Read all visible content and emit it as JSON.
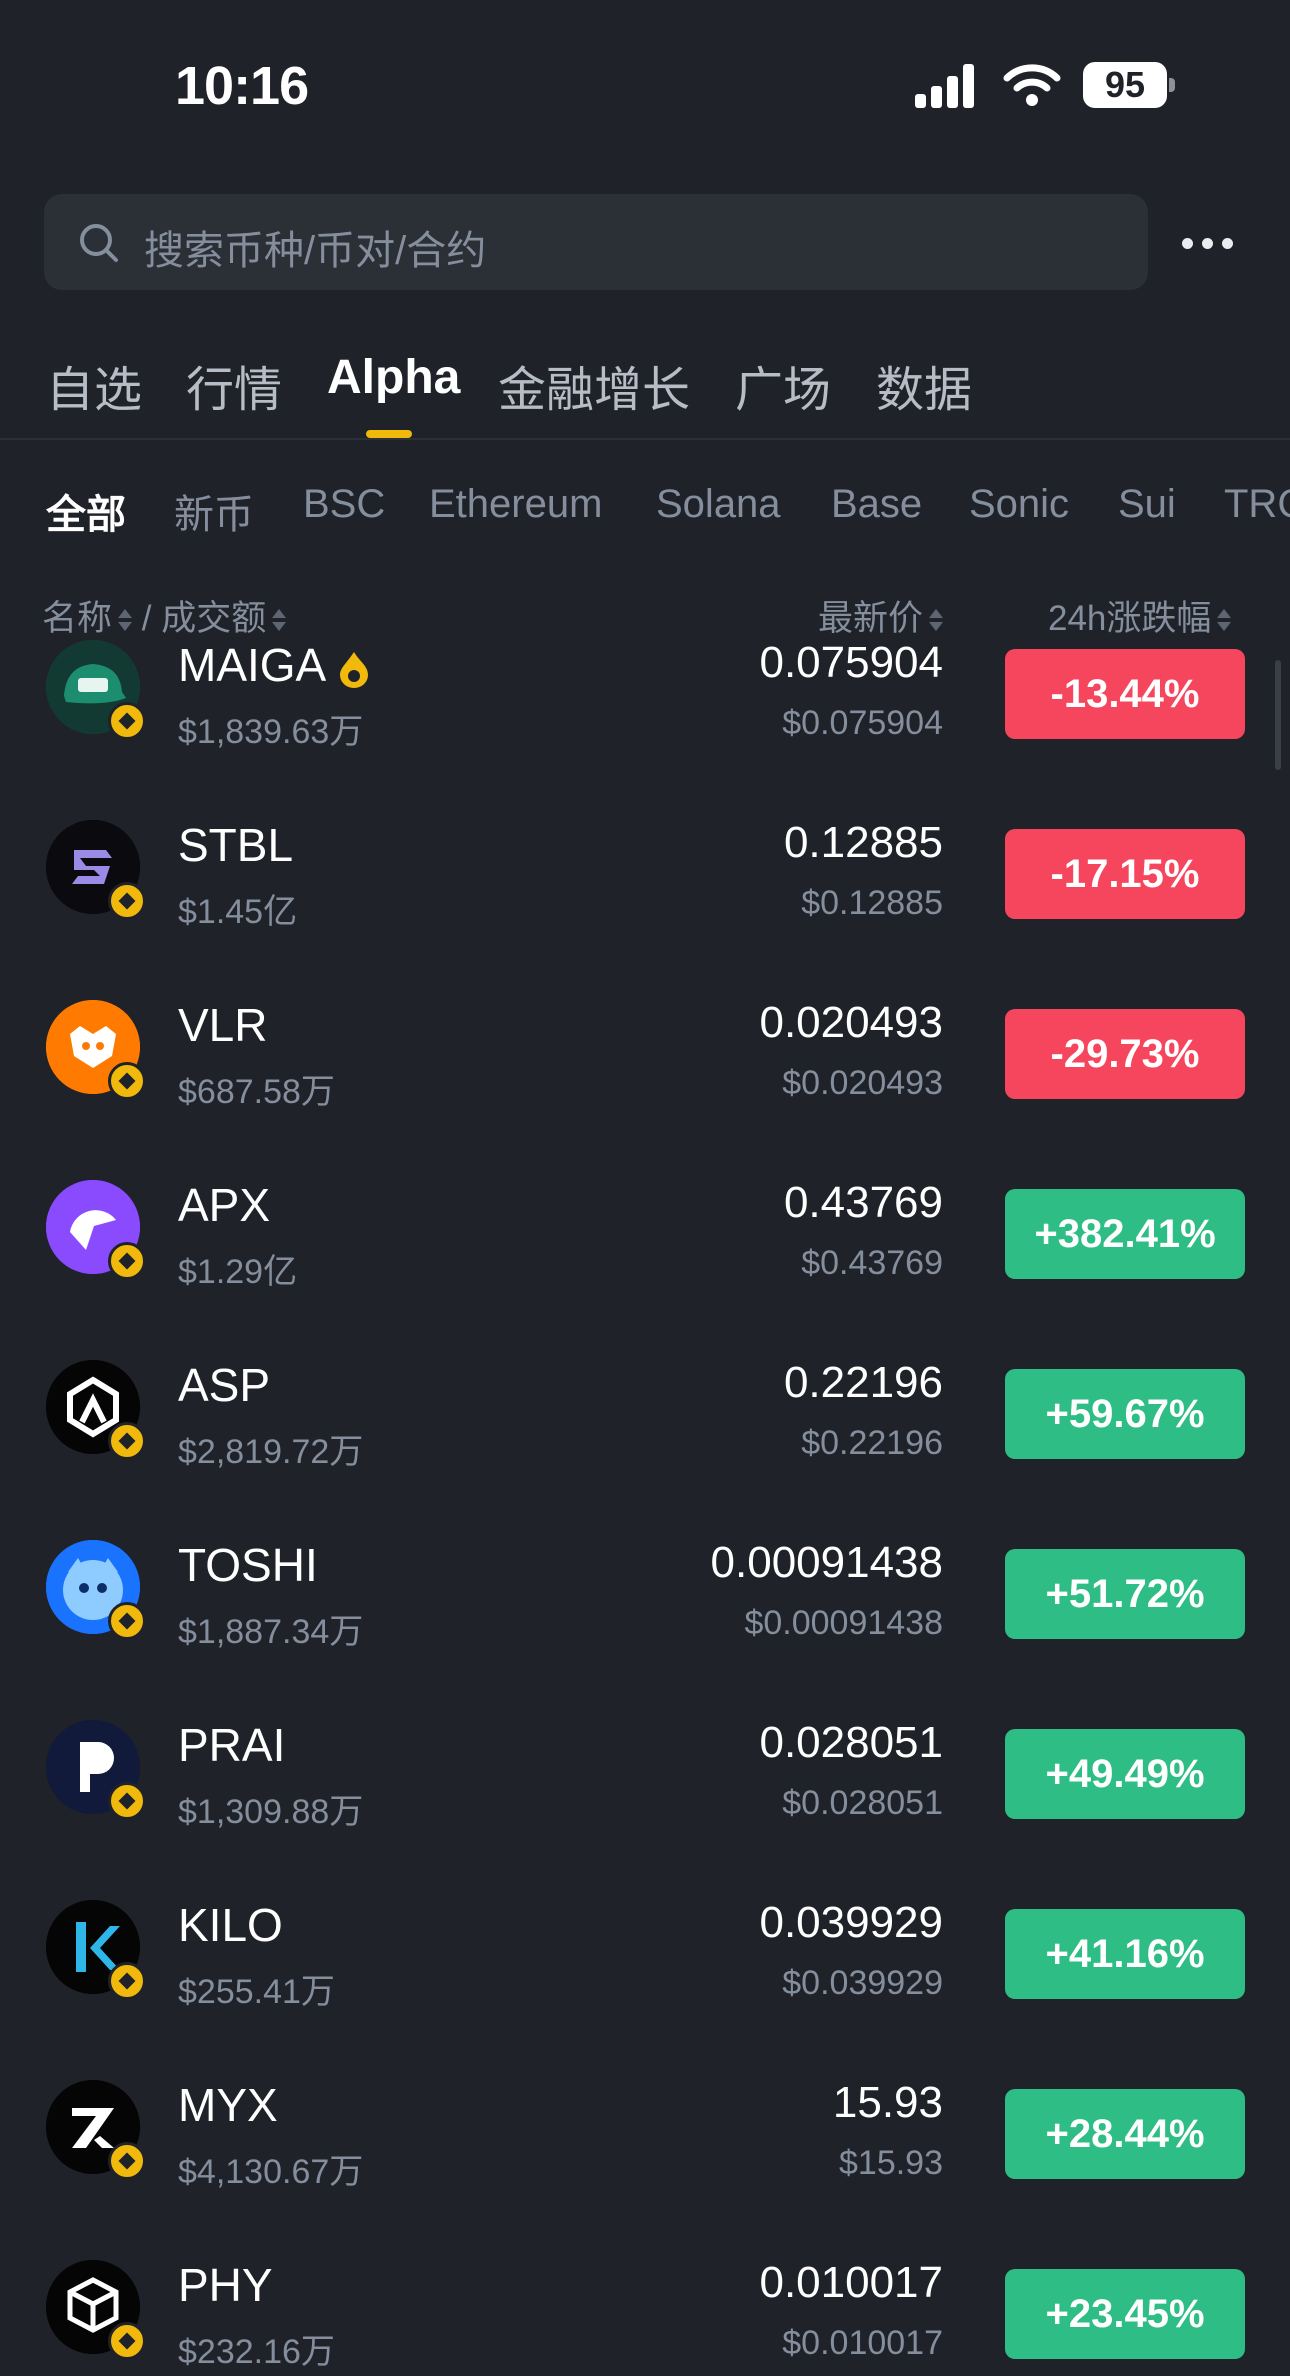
{
  "status_bar": {
    "time": "10:16",
    "battery": "95"
  },
  "search": {
    "placeholder": "搜索币种/币对/合约"
  },
  "main_tabs": [
    "自选",
    "行情",
    "Alpha",
    "金融增长",
    "广场",
    "数据"
  ],
  "chain_tabs": [
    "全部",
    "新币",
    "BSC",
    "Ethereum",
    "Solana",
    "Base",
    "Sonic",
    "Sui",
    "TRC"
  ],
  "columns": {
    "name": "名称",
    "separator": "/",
    "volume": "成交额",
    "price": "最新价",
    "change": "24h涨跌幅"
  },
  "colors": {
    "down": "#f6465d",
    "up": "#2ebd85",
    "accent": "#f0b90b"
  },
  "coins": [
    {
      "name": "MAIGA",
      "volume": "$1,839.63万",
      "price": "0.075904",
      "price_usd": "$0.075904",
      "change": "-13.44%",
      "direction": "down",
      "icon": "maiga-cap-icon",
      "hot": true
    },
    {
      "name": "STBL",
      "volume": "$1.45亿",
      "price": "0.12885",
      "price_usd": "$0.12885",
      "change": "-17.15%",
      "direction": "down",
      "icon": "stbl-logo-icon"
    },
    {
      "name": "VLR",
      "volume": "$687.58万",
      "price": "0.020493",
      "price_usd": "$0.020493",
      "change": "-29.73%",
      "direction": "down",
      "icon": "vlr-fox-icon"
    },
    {
      "name": "APX",
      "volume": "$1.29亿",
      "price": "0.43769",
      "price_usd": "$0.43769",
      "change": "+382.41%",
      "direction": "up",
      "icon": "apx-logo-icon"
    },
    {
      "name": "ASP",
      "volume": "$2,819.72万",
      "price": "0.22196",
      "price_usd": "$0.22196",
      "change": "+59.67%",
      "direction": "up",
      "icon": "asp-logo-icon"
    },
    {
      "name": "TOSHI",
      "volume": "$1,887.34万",
      "price": "0.00091438",
      "price_usd": "$0.00091438",
      "change": "+51.72%",
      "direction": "up",
      "icon": "toshi-cat-icon"
    },
    {
      "name": "PRAI",
      "volume": "$1,309.88万",
      "price": "0.028051",
      "price_usd": "$0.028051",
      "change": "+49.49%",
      "direction": "up",
      "icon": "prai-logo-icon"
    },
    {
      "name": "KILO",
      "volume": "$255.41万",
      "price": "0.039929",
      "price_usd": "$0.039929",
      "change": "+41.16%",
      "direction": "up",
      "icon": "kilo-logo-icon"
    },
    {
      "name": "MYX",
      "volume": "$4,130.67万",
      "price": "15.93",
      "price_usd": "$15.93",
      "change": "+28.44%",
      "direction": "up",
      "icon": "myx-logo-icon"
    },
    {
      "name": "PHY",
      "volume": "$232.16万",
      "price": "0.010017",
      "price_usd": "$0.010017",
      "change": "+23.45%",
      "direction": "up",
      "icon": "phy-logo-icon"
    }
  ]
}
